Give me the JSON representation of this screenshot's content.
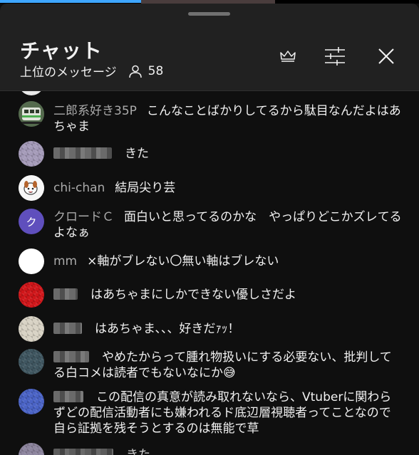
{
  "colors": {
    "background": "#0f0f0f",
    "header_bg": "#212121",
    "progress": "#3ea6ff",
    "author_text": "#aaaaaa",
    "message_text": "#f1f1f1",
    "avatar_purple": "#5f4fbd"
  },
  "header": {
    "title": "チャット",
    "subtitle": "上位のメッセージ",
    "viewer_count": "58",
    "icons": [
      "crown-icon",
      "tune-icon",
      "close-icon"
    ]
  },
  "messages": [
    {
      "author": "二郎系好き35P",
      "text": "こんなことばかりしてるから駄目なんだよはあちゃま",
      "avatar": "train"
    },
    {
      "author": "",
      "text": "きた",
      "avatar": "lavender"
    },
    {
      "author": "chi-chan",
      "text": "結局尖り芸",
      "avatar": "cartoon"
    },
    {
      "author": "クロードＣ",
      "text": "面白いと思ってるのかな　やっぱりどこかズレてるよなぁ",
      "avatar": "letter",
      "avatar_letter": "ク"
    },
    {
      "author": "mm",
      "text": "×軸がブレない〇無い軸はブレない",
      "avatar": "white"
    },
    {
      "author": "",
      "text": "はあちゃまにしかできない優しさだよ",
      "avatar": "red"
    },
    {
      "author": "",
      "text": "はあちゃま、、、好きだｧｯ！",
      "avatar": "cream"
    },
    {
      "author": "",
      "text": "やめたからって腫れ物扱いにする必要ない、批判してる白コメは読者でもないなにか😅",
      "avatar": "teal"
    },
    {
      "author": "",
      "text": "この配信の真意が読み取れないなら、Vtuberに関わらずどの配信活動者にも嫌われるド底辺層視聴者ってことなので自ら証拠を残そうとするのは無能で草",
      "avatar": "blue"
    },
    {
      "author": "",
      "text": "きた",
      "avatar": "lavender"
    }
  ]
}
